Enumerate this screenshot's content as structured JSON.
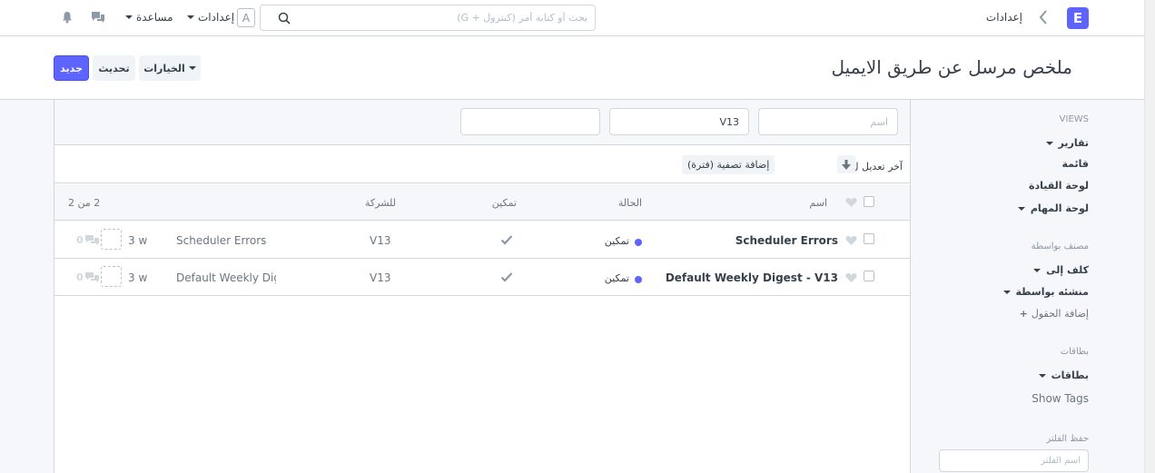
{
  "navbar": {
    "logo_letter": "E",
    "breadcrumb": "إعدادات",
    "search_placeholder": "بحث أو كتابة أمر (كنترول + G)",
    "avatar_letter": "A",
    "settings_label": "إعدادات",
    "help_label": "مساعدة",
    "icons": [
      "chevron-left-icon",
      "search-icon",
      "chat-icon",
      "bell-icon"
    ]
  },
  "page": {
    "title": "ملخص مرسل عن طريق الايميل",
    "new_label": "جديد",
    "refresh_label": "تحديث",
    "options_label": "الخيارات"
  },
  "filters": {
    "name_placeholder": "اسم",
    "company_value": "V13",
    "third_value": ""
  },
  "sort": {
    "label": "آخر تعديل ل",
    "add_filter": "إضافة تصفية (فترة)"
  },
  "list": {
    "headers": {
      "name": "اسم",
      "status": "الحالة",
      "enabled": "تمكين",
      "company": "للشركة",
      "count": "2 من 2"
    },
    "rows": [
      {
        "name": "Scheduler Errors",
        "status": "تمكين",
        "company": "V13",
        "subject": "Scheduler Errors",
        "modified": "3 w",
        "comments": "0"
      },
      {
        "name": "Default Weekly Digest - V13",
        "status": "تمكين",
        "company": "V13",
        "subject": "Default Weekly Digest",
        "modified": "3 w",
        "comments": "0"
      }
    ]
  },
  "sidebar": {
    "views_heading": "VIEWS",
    "reports": "تقارير",
    "list": "قائمة",
    "dashboard": "لوحة القيادة",
    "kanban": "لوحة المهام",
    "classified_heading": "مصنف بواسطة",
    "assigned_to": "كلف إلى",
    "created_by": "منشئه بواسطة",
    "add_fields": "إضافة الحقول",
    "tags_heading": "بطاقات",
    "tags": "بطاقات",
    "show_tags": "Show Tags",
    "save_filter_heading": "حفظ الفلتر",
    "filter_name_placeholder": "اسم الفلتر"
  },
  "colors": {
    "primary": "#5e64ff",
    "border": "#d1d8dd",
    "text": "#36414c",
    "muted": "#8d99a6",
    "panel": "#f5f7fa"
  }
}
